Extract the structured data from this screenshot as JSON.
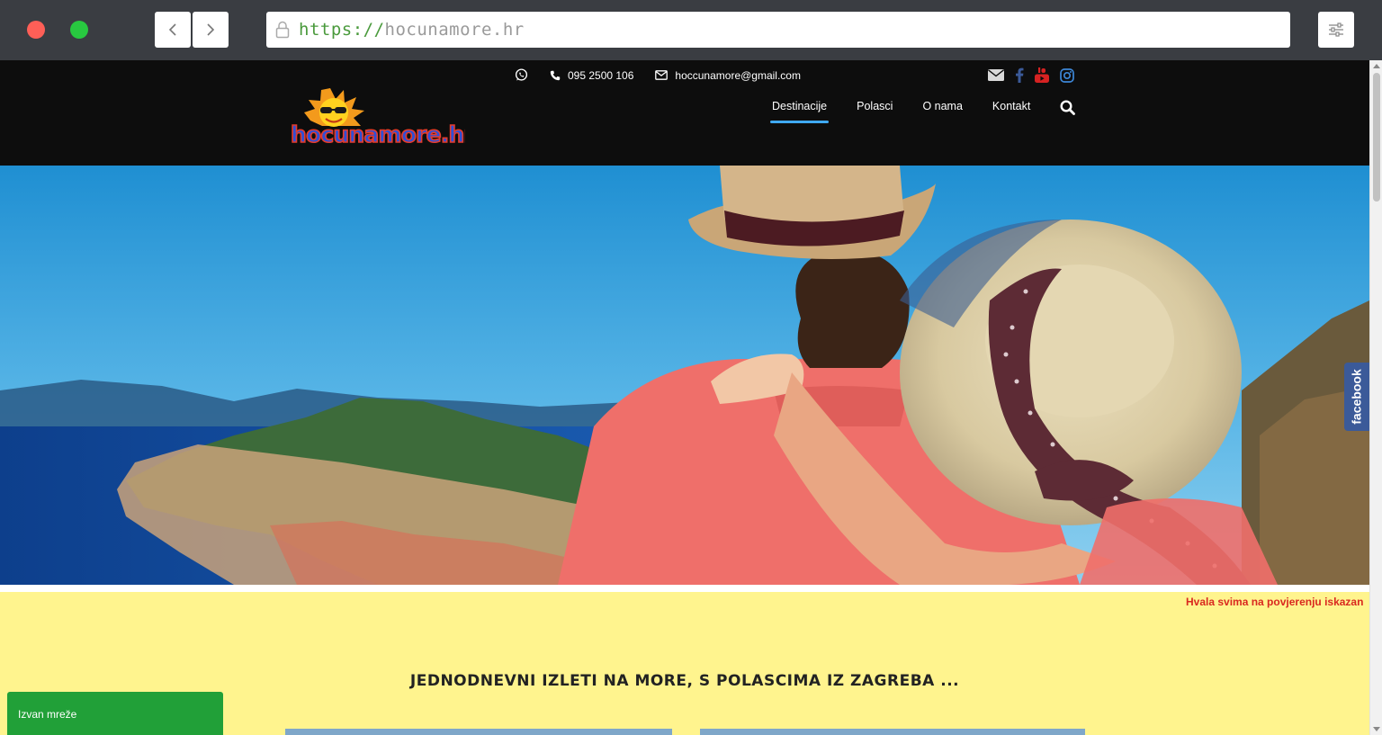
{
  "browser": {
    "url_scheme": "https://",
    "url_host": "hocunamore.hr"
  },
  "header": {
    "phone": "095 2500 106",
    "email": "hoccunamore@gmail.com",
    "logo_text": "hocunamore.hr",
    "nav": [
      "Destinacije",
      "Polasci",
      "O nama",
      "Kontakt"
    ],
    "active_nav": "Destinacije"
  },
  "colors": {
    "header_bg": "#0d0d0d",
    "nav_underline": "#3fa9f5",
    "notice_bg": "#fff48e",
    "notice_text": "#d9281f",
    "facebook": "#3b5a99",
    "status_green": "#21a038"
  },
  "icons": [
    "whatsapp-icon",
    "phone-icon",
    "envelope-icon",
    "mail-icon",
    "facebook-icon",
    "youtube-icon",
    "instagram-icon",
    "search-icon",
    "lock-icon",
    "sliders-icon"
  ],
  "facebook_tab": "facebook",
  "notice": {
    "marquee": "Hvala svima na povjerenju iskazan",
    "tagline": "JEDNODNEVNI IZLETI NA MORE, S POLASCIMA IZ ZAGREBA ..."
  },
  "status": {
    "offline_label": "Izvan mreže"
  }
}
